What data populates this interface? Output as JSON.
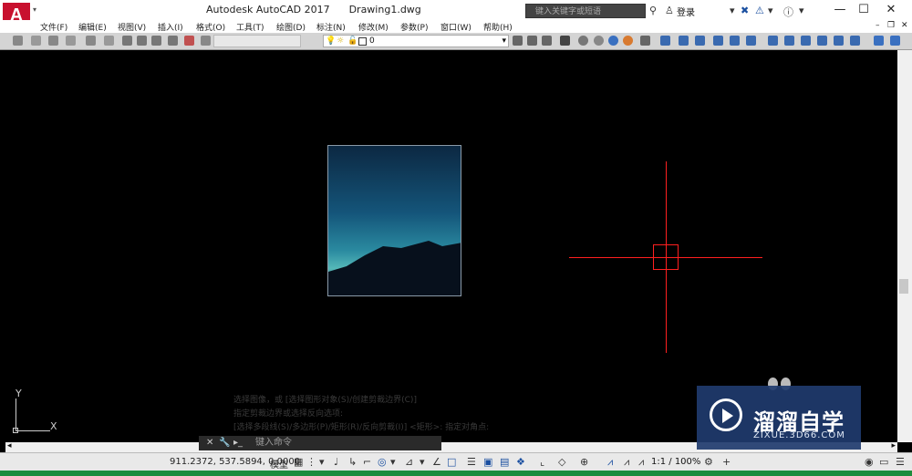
{
  "title": {
    "app": "Autodesk AutoCAD 2017",
    "doc": "Drawing1.dwg"
  },
  "search": {
    "placeholder": "键入关键字或短语"
  },
  "user": {
    "login": "登录"
  },
  "window": {
    "minimize": "—",
    "maximize": "☐",
    "close": "✕"
  },
  "menu": {
    "items": [
      "文件(F)",
      "编辑(E)",
      "视图(V)",
      "插入(I)",
      "格式(O)",
      "工具(T)",
      "绘图(D)",
      "标注(N)",
      "修改(M)",
      "参数(P)",
      "窗口(W)",
      "帮助(H)"
    ]
  },
  "layer": {
    "current": "0"
  },
  "command": {
    "history": [
      "选择图像，或 [选择图形对象(S)/创建剪裁边界(C)]",
      "指定剪裁边界或选择反向选项:",
      "[选择多段线(S)/多边形(P)/矩形(R)/反向剪裁(I)] <矩形>: 指定对角点:"
    ],
    "prompt": "键入命令"
  },
  "ucs": {
    "x": "X",
    "y": "Y"
  },
  "status": {
    "coords": "911.2372, 537.5894, 0.0000",
    "space": "模型",
    "scale": "1:1 / 100%"
  },
  "watermark": {
    "title": "溜溜自学",
    "subtitle": "ZIXUE.3D66.COM"
  },
  "colors": {
    "accent": "#c8102e",
    "crosshair": "#ff2020",
    "watermark": "#1f3b6e"
  }
}
